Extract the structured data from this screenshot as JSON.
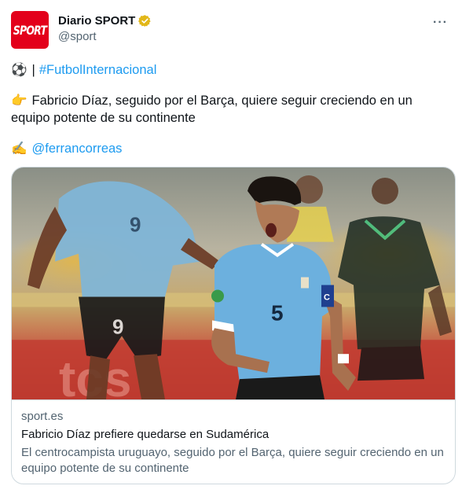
{
  "account": {
    "logo_text": "SPORT",
    "display_name": "Diario SPORT",
    "handle": "@sport",
    "verified_badge": "gold-verified-icon",
    "more_label": "···"
  },
  "tweet": {
    "line1_emoji": "⚽",
    "line1_separator": "|",
    "hashtag": "#FutbolInternacional",
    "line2_emoji": "👉",
    "line2_text": "Fabricio Díaz, seguido por el Barça, quiere seguir creciendo en un equipo potente de su continente",
    "line3_emoji": "✍️",
    "mention": "@ferrancorreas"
  },
  "card": {
    "domain": "sport.es",
    "title": "Fabricio Díaz prefiere quedarse en Sudamérica",
    "description": "El centrocampista uruguayo, seguido por el Barça, quiere seguir creciendo en un equipo potente de su continente",
    "image": {
      "front_shirt_number": "5",
      "left_shirt_number": "9",
      "armband_text": "C"
    }
  },
  "colors": {
    "brand_red": "#e3001b",
    "link_blue": "#1d9bf0",
    "secondary_text": "#536471",
    "uruguay_blue": "#6cb0de"
  }
}
